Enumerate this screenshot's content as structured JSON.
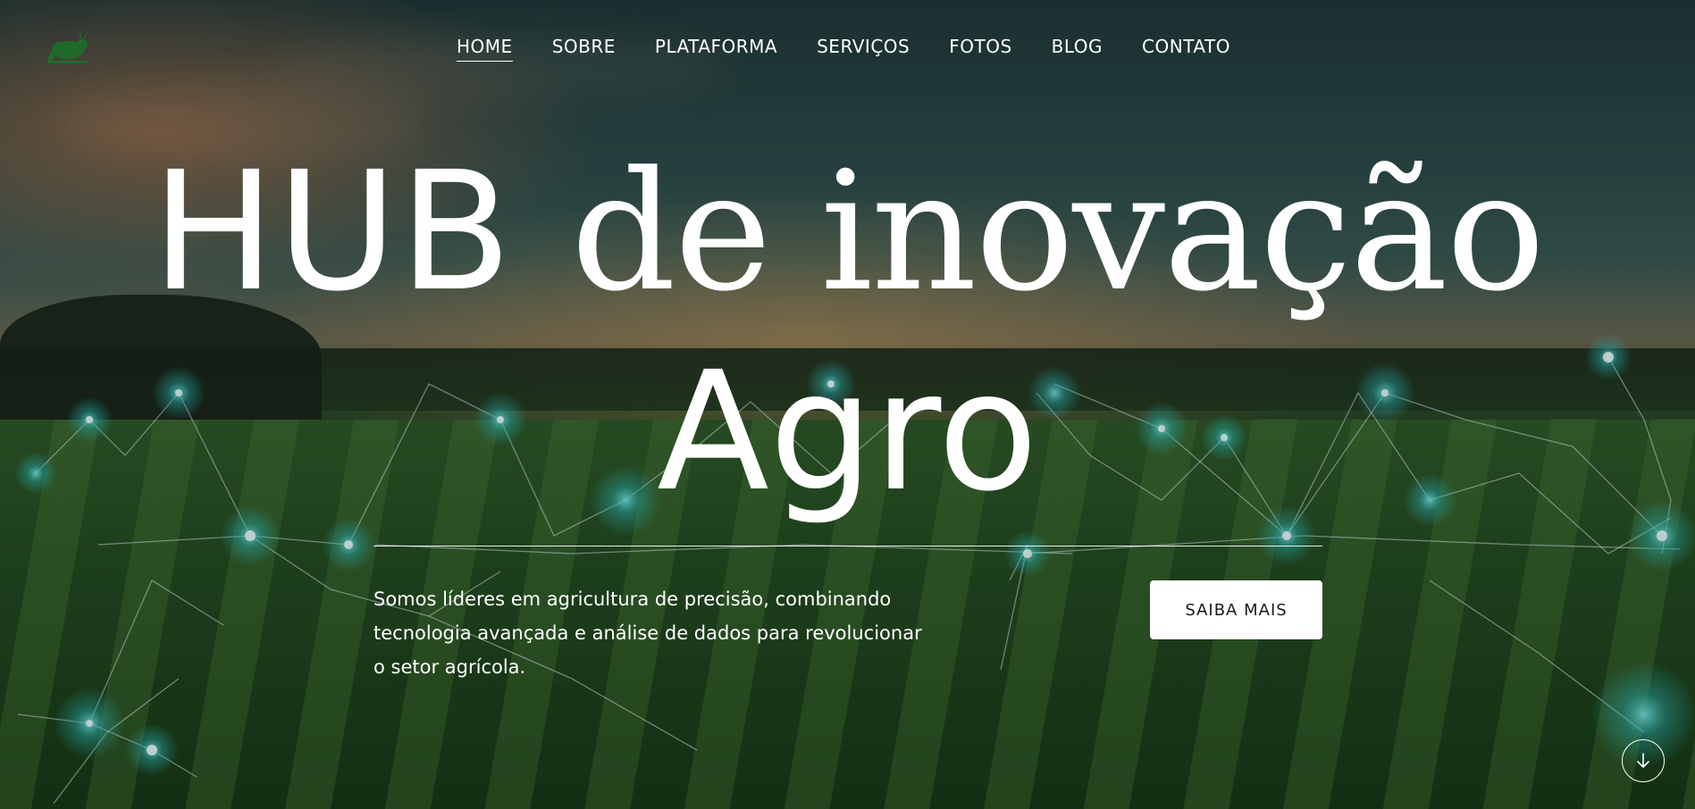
{
  "nav": {
    "items": [
      {
        "label": "HOME",
        "active": true
      },
      {
        "label": "SOBRE",
        "active": false
      },
      {
        "label": "PLATAFORMA",
        "active": false
      },
      {
        "label": "SERVIÇOS",
        "active": false
      },
      {
        "label": "FOTOS",
        "active": false
      },
      {
        "label": "BLOG",
        "active": false
      },
      {
        "label": "CONTATO",
        "active": false
      }
    ]
  },
  "logo": {
    "icon": "hare-logo-icon",
    "color": "#1f6a2a"
  },
  "hero": {
    "headline_word_1": "HUB",
    "headline_word_2": "de inovação",
    "headline_line_2": "Agro",
    "description": "Somos líderes em agricultura de precisão, combinando tecnologia avançada e análise de dados para revolucionar o setor agrícola.",
    "cta_label": "SAIBA MAIS",
    "scroll_icon": "arrow-down-icon"
  },
  "colors": {
    "text": "#ffffff",
    "cta_background": "#ffffff",
    "cta_text": "#1a1a1a",
    "network_glow": "#3fd6d6"
  }
}
